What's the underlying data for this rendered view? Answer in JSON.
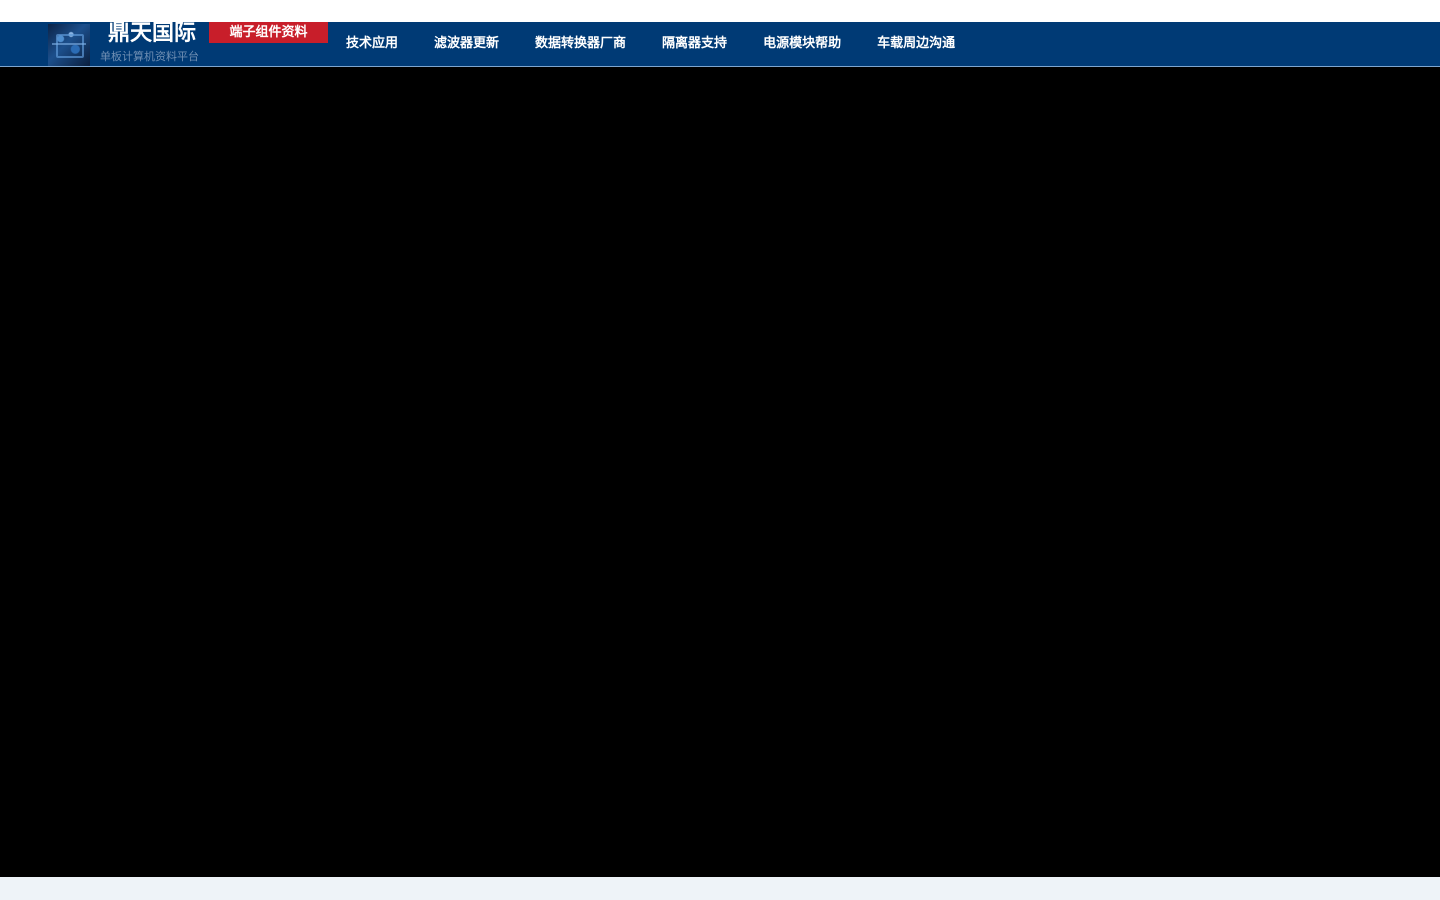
{
  "brand": {
    "title": "鼎天国际",
    "badge": "端子组件资料",
    "subtitle": "单板计算机资料平台"
  },
  "nav": {
    "items": [
      {
        "label": "技术应用"
      },
      {
        "label": "滤波器更新"
      },
      {
        "label": "数据转换器厂商"
      },
      {
        "label": "隔离器支持"
      },
      {
        "label": "电源模块帮助"
      },
      {
        "label": "车载周边沟通"
      }
    ]
  },
  "colors": {
    "header_bg": "#003a75",
    "badge_bg": "#c81e2a",
    "main_bg": "#000000",
    "footer_bg": "#eef3f8"
  }
}
